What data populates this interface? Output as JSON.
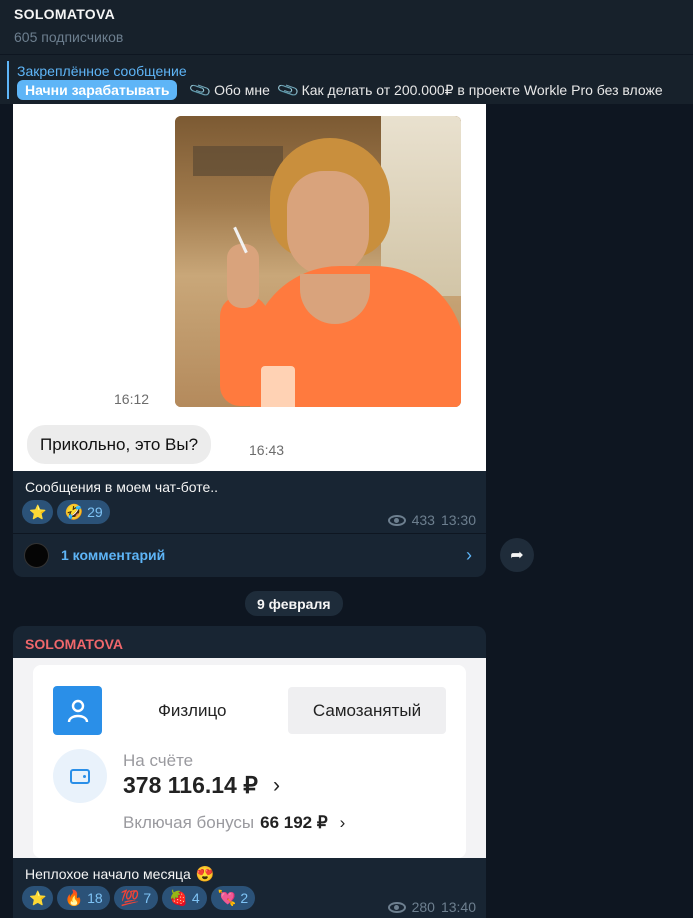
{
  "header": {
    "channel_title": "SOLOMATOVA",
    "subscribers": "605 подписчиков"
  },
  "pinned": {
    "label": "Закреплённое сообщение",
    "button_label": "Начни зарабатывать",
    "links": [
      "Обо мне",
      "Как делать от 200.000₽ в проекте Workle Pro без вложе"
    ]
  },
  "post1": {
    "image_time_1": "16:12",
    "chat_bubble": "Прикольно, это Вы?",
    "image_time_2": "16:43",
    "caption": "Сообщения в моем чат-боте..",
    "reactions": [
      {
        "emoji": "⭐",
        "count": ""
      },
      {
        "emoji": "🤣",
        "count": "29"
      }
    ],
    "views": "433",
    "time": "13:30",
    "comments_label": "1 комментарий"
  },
  "date_separator": "9 февраля",
  "post2": {
    "author": "SOLOMATOVA",
    "widget": {
      "tab_individual": "Физлицо",
      "tab_selfemployed": "Самозанятый",
      "balance_label": "На счёте",
      "balance_value": "378 116.14 ₽",
      "bonus_label": "Включая бонусы",
      "bonus_value": "66 192 ₽"
    },
    "caption": "Неплохое начало месяца",
    "caption_emoji": "😍",
    "reactions": [
      {
        "emoji": "⭐",
        "count": ""
      },
      {
        "emoji": "🔥",
        "count": "18"
      },
      {
        "emoji": "💯",
        "count": "7"
      },
      {
        "emoji": "🍓",
        "count": "4"
      },
      {
        "emoji": "💘",
        "count": "2"
      }
    ],
    "views": "280",
    "time": "13:40"
  },
  "colors": {
    "background": "#0e1621",
    "panel": "#17212b",
    "bubble": "#182533",
    "accent": "#5eb5f7",
    "author": "#f0676b"
  }
}
